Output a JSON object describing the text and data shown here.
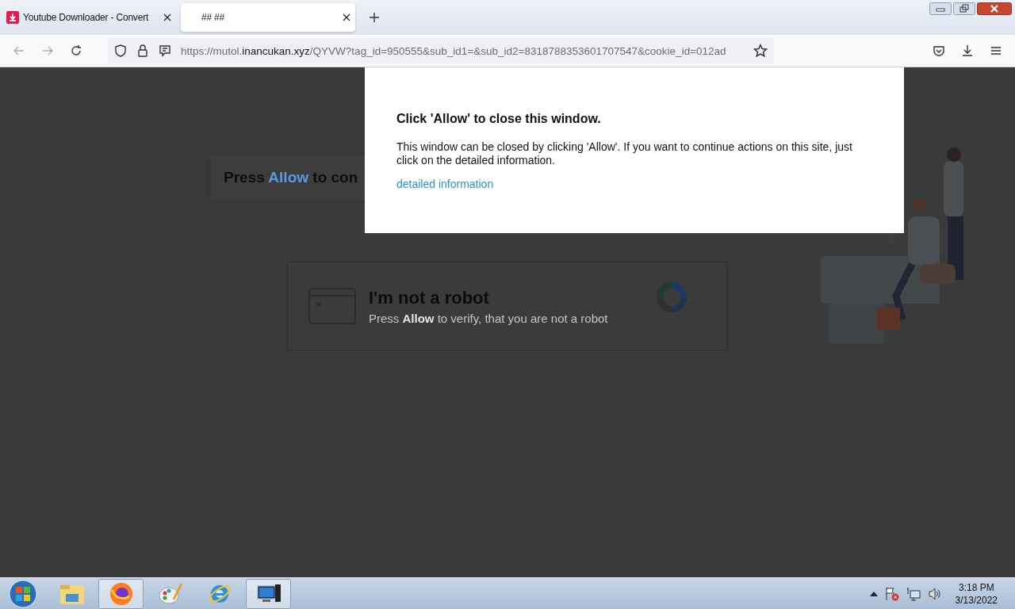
{
  "tabs": [
    {
      "title": "Youtube Downloader - Convert",
      "selected": false,
      "has_icon": true
    },
    {
      "title": "## ##",
      "selected": true,
      "has_icon": false
    }
  ],
  "address_bar": {
    "prefix": "https://mutol.",
    "domain": "inancukan.xyz",
    "path": "/QYVW?tag_id=950555&sub_id1=&sub_id2=8318788353601707547&cookie_id=012ad"
  },
  "page": {
    "banner": {
      "before": "Press",
      "highlight": "Allow",
      "after": "to con"
    },
    "captcha": {
      "title": "I'm not a robot",
      "subtitle": "Press **Allow** to verify, that you are not a robot"
    }
  },
  "dialog": {
    "title": "Click 'Allow' to close this window.",
    "body": "This window can be closed by clicking 'Allow'. If you want to continue actions on this site, just click on the detailed information.",
    "link": "detailed information"
  },
  "taskbar": {
    "items": [
      {
        "kind": "start",
        "active": false
      },
      {
        "kind": "folder",
        "active": false
      },
      {
        "kind": "firefox",
        "active": true
      },
      {
        "kind": "paint",
        "active": false
      },
      {
        "kind": "ie",
        "active": false
      },
      {
        "kind": "remote",
        "active": true
      }
    ],
    "clock": {
      "time": "3:18 PM",
      "date": "3/13/2022"
    }
  }
}
